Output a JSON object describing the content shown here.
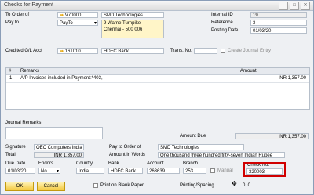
{
  "window": {
    "title": "Checks for Payment",
    "min": "–",
    "max": "□",
    "close": "✕"
  },
  "header": {
    "to_order_of_label": "To Order of",
    "to_order_of_code": "V70000",
    "to_order_of_name": "SMD Technologies",
    "pay_to_label": "Pay to",
    "pay_to_value": "PayTo",
    "address_line1": "9 Warne Turnpike",
    "address_line2": "Chennai - 500 006",
    "internal_id_label": "Internal ID",
    "internal_id": "19",
    "reference_label": "Reference",
    "reference": "3",
    "posting_date_label": "Posting Date",
    "posting_date": "01/03/20",
    "credited_gl_label": "Credited G/L Acct",
    "credited_gl_code": "161010",
    "credited_gl_name": "HDFC Bank",
    "trans_no_label": "Trans. No.",
    "trans_no": "",
    "create_journal_entry_label": "Create Journal Entry"
  },
  "table": {
    "columns": [
      "#",
      "Remarks",
      "Amount"
    ],
    "rows": [
      {
        "num": "1",
        "remarks": "A/P Invoices included in Payment:*403,",
        "amount": "INR 1,357.00"
      }
    ]
  },
  "footer": {
    "journal_remarks_label": "Journal Remarks",
    "journal_remarks": "",
    "amount_due_label": "Amount Due",
    "amount_due": "INR 1,357.00",
    "signature_label": "Signature",
    "signature": "OEC Computers India",
    "pay_to_order_of_label": "Pay to Order of",
    "pay_to_order_of": "SMD Technologies",
    "total_label": "Total",
    "total": "INR 1,357.00",
    "amount_in_words_label": "Amount in Words",
    "amount_in_words": "One thousand three hundred fifty-seven Indian Rupee",
    "due_date_label": "Due Date",
    "due_date": "01/03/20",
    "endors_label": "Endors.",
    "endors": "No",
    "country_label": "Country",
    "country": "India",
    "bank_label": "Bank",
    "bank": "HDFC Bank",
    "account_label": "Account",
    "account": "263639",
    "branch_label": "Branch",
    "branch": "253",
    "manual_label": "Manual",
    "check_no_label": "Check No.",
    "check_no": "320003"
  },
  "actions": {
    "ok": "OK",
    "cancel": "Cancel",
    "print_on_blank_paper": "Print on Blank Paper",
    "printing_spacing": "Printing/Spacing",
    "spacing_value": "0, 0",
    "spacing_icon": "move-arrows-icon"
  }
}
